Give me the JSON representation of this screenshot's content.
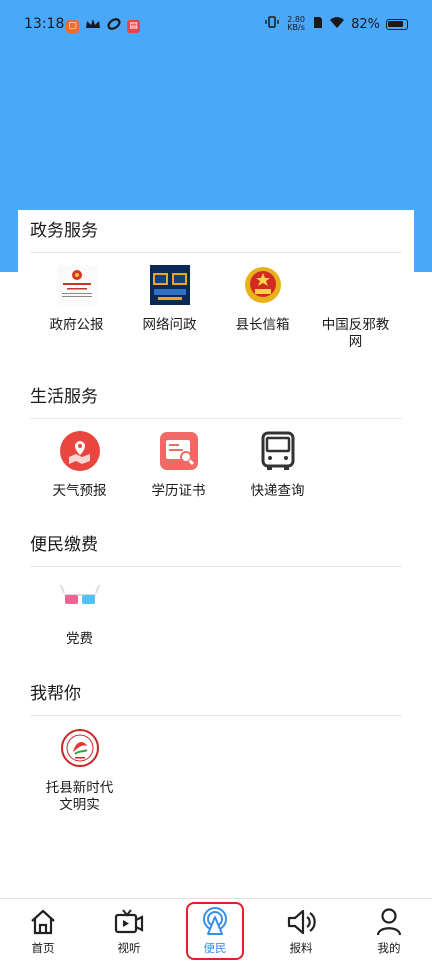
{
  "status": {
    "time": "13:18",
    "speed_top": "2.80",
    "speed_bottom": "KB/s",
    "battery": "82%"
  },
  "sections": [
    {
      "title": "政务服务",
      "items": [
        {
          "label": "政府公报",
          "icon": "gazette-icon"
        },
        {
          "label": "网络问政",
          "icon": "online-inquiry-icon"
        },
        {
          "label": "县长信箱",
          "icon": "national-emblem-icon"
        },
        {
          "label": "中国反邪教网",
          "icon": ""
        }
      ]
    },
    {
      "title": "生活服务",
      "items": [
        {
          "label": "天气预报",
          "icon": "weather-map-icon"
        },
        {
          "label": "学历证书",
          "icon": "certificate-search-icon"
        },
        {
          "label": "快递查询",
          "icon": "bus-icon"
        }
      ]
    },
    {
      "title": "便民缴费",
      "items": [
        {
          "label": "党费",
          "icon": "glasses-icon"
        }
      ]
    },
    {
      "title": "我帮你",
      "items": [
        {
          "label": "托县新时代文明实",
          "icon": "civilization-badge-icon"
        }
      ]
    }
  ],
  "tabs": [
    {
      "label": "首页",
      "icon": "home-icon"
    },
    {
      "label": "视听",
      "icon": "video-icon"
    },
    {
      "label": "便民",
      "icon": "broadcast-icon",
      "active": true
    },
    {
      "label": "报料",
      "icon": "speaker-icon"
    },
    {
      "label": "我的",
      "icon": "user-icon"
    }
  ],
  "colors": {
    "hero": "#4aa8fb",
    "accent": "#3a8ee6",
    "highlight": "#e0202a"
  }
}
